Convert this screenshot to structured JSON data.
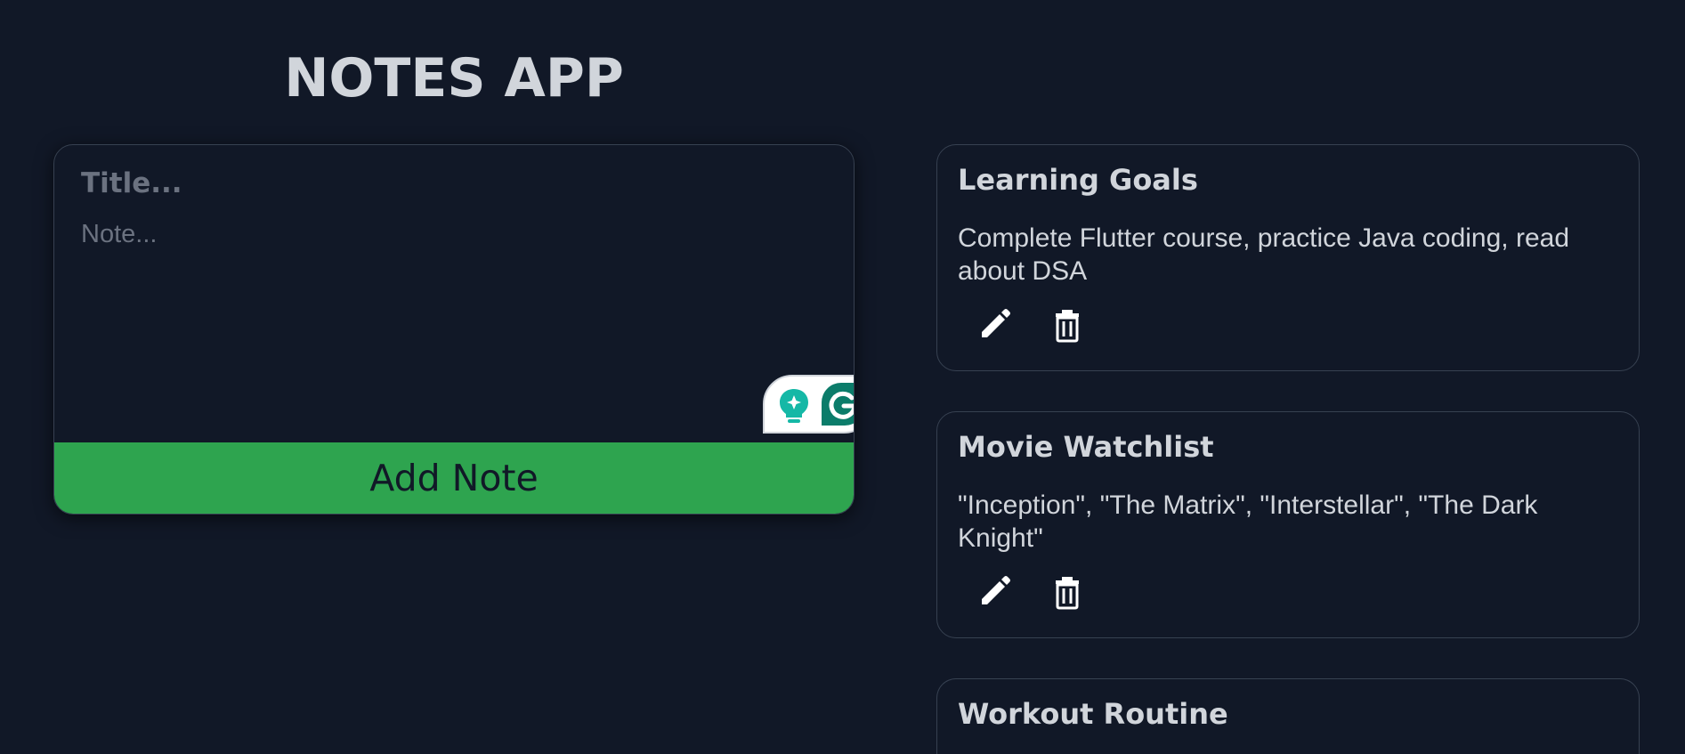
{
  "header": {
    "title": "NOTES APP"
  },
  "composer": {
    "title_placeholder": "Title...",
    "title_value": "",
    "note_placeholder": "Note...",
    "note_value": "",
    "add_button_label": "Add Note",
    "accent_color": "#2ea44f",
    "grammarly_icons": [
      "lightbulb-sparkle-icon",
      "grammarly-g-icon"
    ]
  },
  "notes": [
    {
      "title": "Learning Goals",
      "body": "Complete Flutter course, practice Java coding, read about DSA",
      "edit_icon": "pencil-icon",
      "delete_icon": "trash-icon"
    },
    {
      "title": "Movie Watchlist",
      "body": "\"Inception\", \"The Matrix\", \"Interstellar\", \"The Dark Knight\"",
      "edit_icon": "pencil-icon",
      "delete_icon": "trash-icon"
    },
    {
      "title": "Workout Routine",
      "body": "",
      "edit_icon": "pencil-icon",
      "delete_icon": "trash-icon"
    }
  ],
  "colors": {
    "background": "#111827",
    "text": "#d1d5db",
    "border": "#374151",
    "placeholder": "#6b7280"
  }
}
